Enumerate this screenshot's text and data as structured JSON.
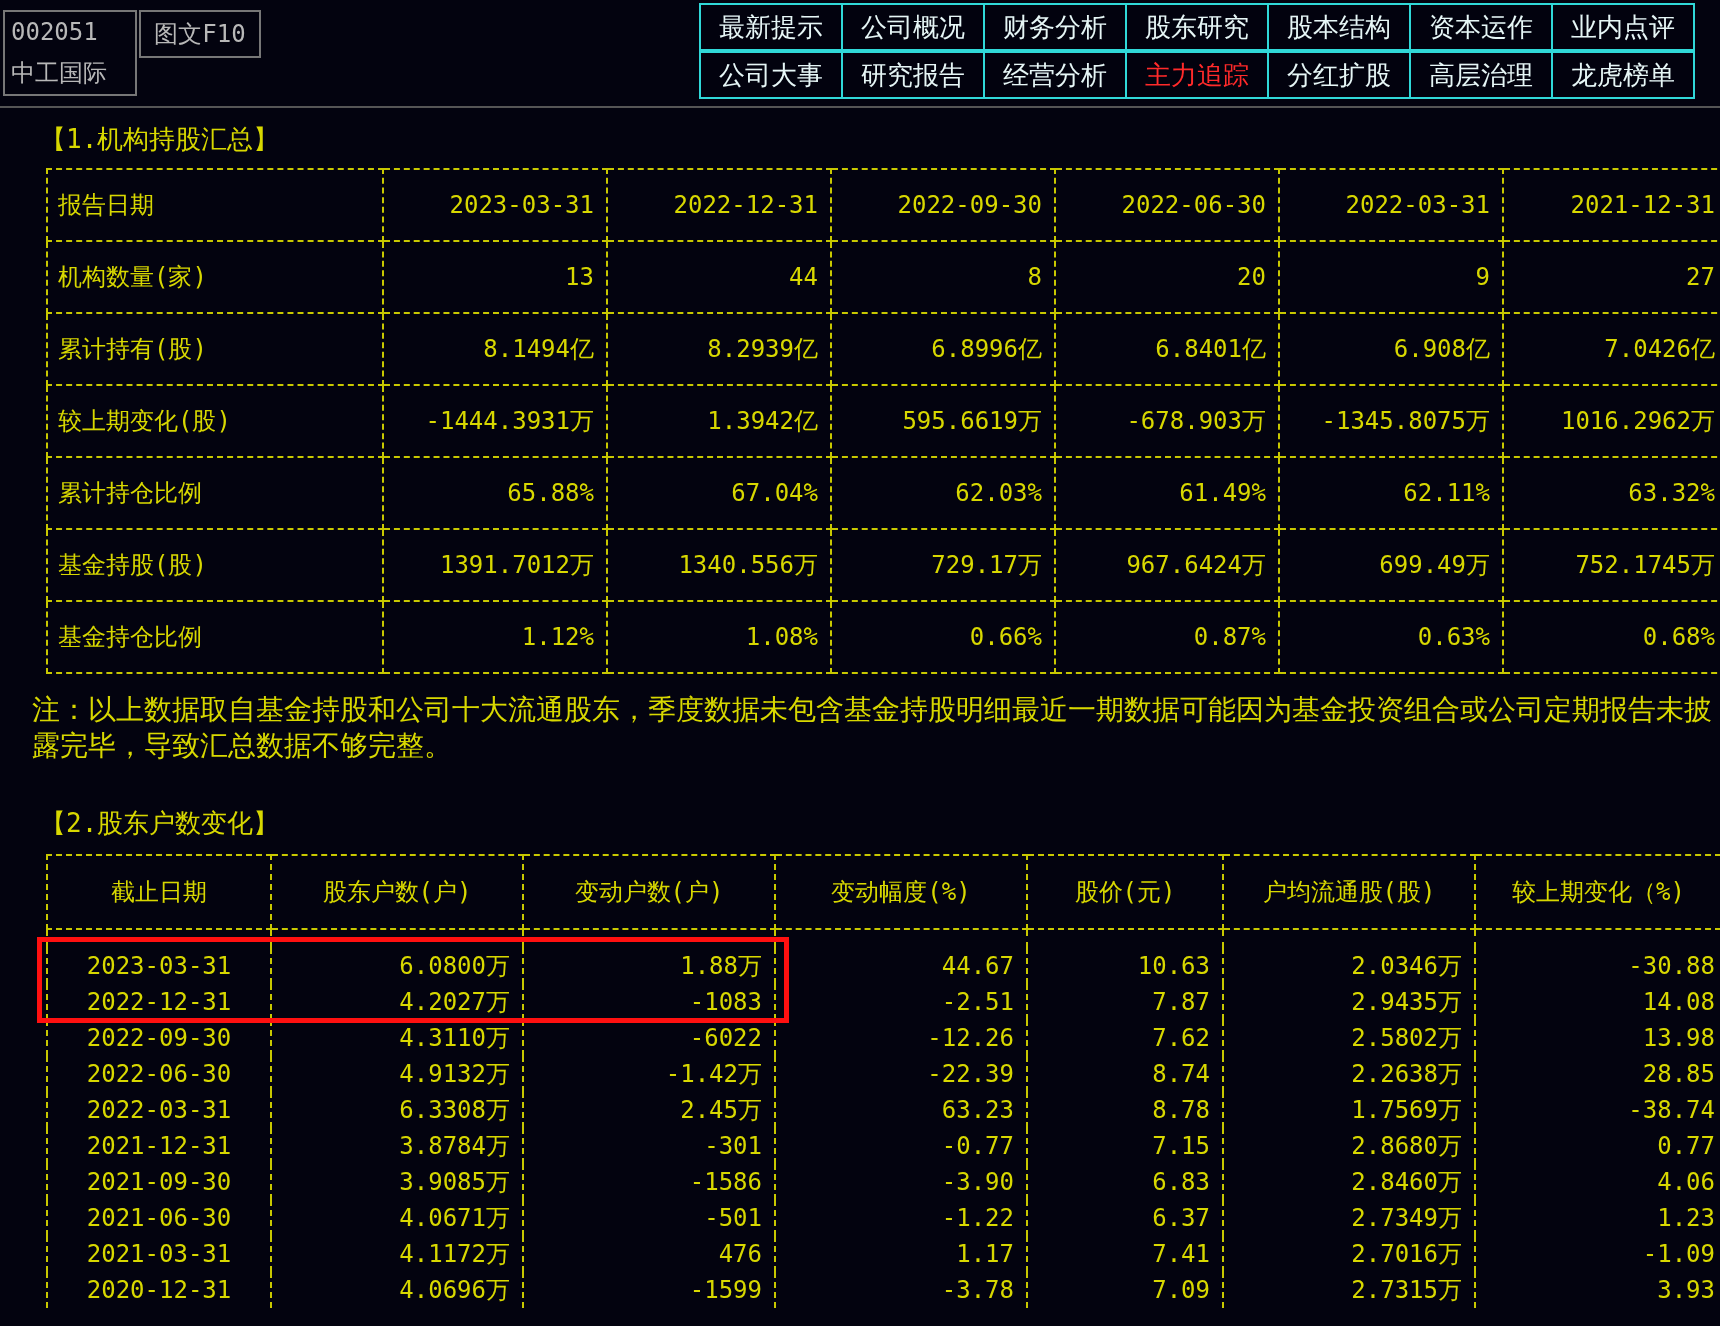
{
  "stock": {
    "code": "002051",
    "name": "中工国际"
  },
  "view_button": {
    "label": "图文F10"
  },
  "nav_rows": [
    {
      "tabs": [
        {
          "label": "最新提示",
          "selected": false
        },
        {
          "label": "公司概况",
          "selected": false
        },
        {
          "label": "财务分析",
          "selected": false
        },
        {
          "label": "股东研究",
          "selected": false
        },
        {
          "label": "股本结构",
          "selected": false
        },
        {
          "label": "资本运作",
          "selected": false
        },
        {
          "label": "业内点评",
          "selected": false
        }
      ]
    },
    {
      "tabs": [
        {
          "label": "公司大事",
          "selected": false
        },
        {
          "label": "研究报告",
          "selected": false
        },
        {
          "label": "经营分析",
          "selected": false
        },
        {
          "label": "主力追踪",
          "selected": true
        },
        {
          "label": "分红扩股",
          "selected": false
        },
        {
          "label": "高层治理",
          "selected": false
        },
        {
          "label": "龙虎榜单",
          "selected": false
        }
      ]
    }
  ],
  "institutional_holdings": {
    "title": "【1.机构持股汇总】",
    "columns": [
      "报告日期",
      "2023-03-31",
      "2022-12-31",
      "2022-09-30",
      "2022-06-30",
      "2022-03-31",
      "2021-12-31"
    ],
    "rows": [
      {
        "label": "机构数量(家)",
        "values": [
          "13",
          "44",
          "8",
          "20",
          "9",
          "27"
        ]
      },
      {
        "label": "累计持有(股)",
        "values": [
          "8.1494亿",
          "8.2939亿",
          "6.8996亿",
          "6.8401亿",
          "6.908亿",
          "7.0426亿"
        ]
      },
      {
        "label": "较上期变化(股)",
        "values": [
          "-1444.3931万",
          "1.3942亿",
          "595.6619万",
          "-678.903万",
          "-1345.8075万",
          "1016.2962万"
        ]
      },
      {
        "label": "累计持仓比例",
        "values": [
          "65.88%",
          "67.04%",
          "62.03%",
          "61.49%",
          "62.11%",
          "63.32%"
        ]
      },
      {
        "label": "基金持股(股)",
        "values": [
          "1391.7012万",
          "1340.556万",
          "729.17万",
          "967.6424万",
          "699.49万",
          "752.1745万"
        ]
      },
      {
        "label": "基金持仓比例",
        "values": [
          "1.12%",
          "1.08%",
          "0.66%",
          "0.87%",
          "0.63%",
          "0.68%"
        ]
      }
    ]
  },
  "note": "注：以上数据取自基金持股和公司十大流通股东，季度数据未包含基金持股明细最近一期数据可能因为基金投资组合或公司定期报告未披露完毕，导致汇总数据不够完整。",
  "shareholder_count": {
    "title": "【2.股东户数变化】",
    "columns": [
      "截止日期",
      "股东户数(户)",
      "变动户数(户)",
      "变动幅度(%)",
      "股价(元)",
      "户均流通股(股)",
      "较上期变化（%)"
    ],
    "rows": [
      {
        "values": [
          "2023-03-31",
          "6.0800万",
          "1.88万",
          "44.67",
          "10.63",
          "2.0346万",
          "-30.88"
        ],
        "highlighted": true
      },
      {
        "values": [
          "2022-12-31",
          "4.2027万",
          "-1083",
          "-2.51",
          "7.87",
          "2.9435万",
          "14.08"
        ],
        "highlighted": true
      },
      {
        "values": [
          "2022-09-30",
          "4.3110万",
          "-6022",
          "-12.26",
          "7.62",
          "2.5802万",
          "13.98"
        ],
        "highlighted": false
      },
      {
        "values": [
          "2022-06-30",
          "4.9132万",
          "-1.42万",
          "-22.39",
          "8.74",
          "2.2638万",
          "28.85"
        ],
        "highlighted": false
      },
      {
        "values": [
          "2022-03-31",
          "6.3308万",
          "2.45万",
          "63.23",
          "8.78",
          "1.7569万",
          "-38.74"
        ],
        "highlighted": false
      },
      {
        "values": [
          "2021-12-31",
          "3.8784万",
          "-301",
          "-0.77",
          "7.15",
          "2.8680万",
          "0.77"
        ],
        "highlighted": false
      },
      {
        "values": [
          "2021-09-30",
          "3.9085万",
          "-1586",
          "-3.90",
          "6.83",
          "2.8460万",
          "4.06"
        ],
        "highlighted": false
      },
      {
        "values": [
          "2021-06-30",
          "4.0671万",
          "-501",
          "-1.22",
          "6.37",
          "2.7349万",
          "1.23"
        ],
        "highlighted": false
      },
      {
        "values": [
          "2021-03-31",
          "4.1172万",
          "476",
          "1.17",
          "7.41",
          "2.7016万",
          "-1.09"
        ],
        "highlighted": false
      },
      {
        "values": [
          "2020-12-31",
          "4.0696万",
          "-1599",
          "-3.78",
          "7.09",
          "2.7315万",
          "3.93"
        ],
        "highlighted": false
      }
    ]
  }
}
